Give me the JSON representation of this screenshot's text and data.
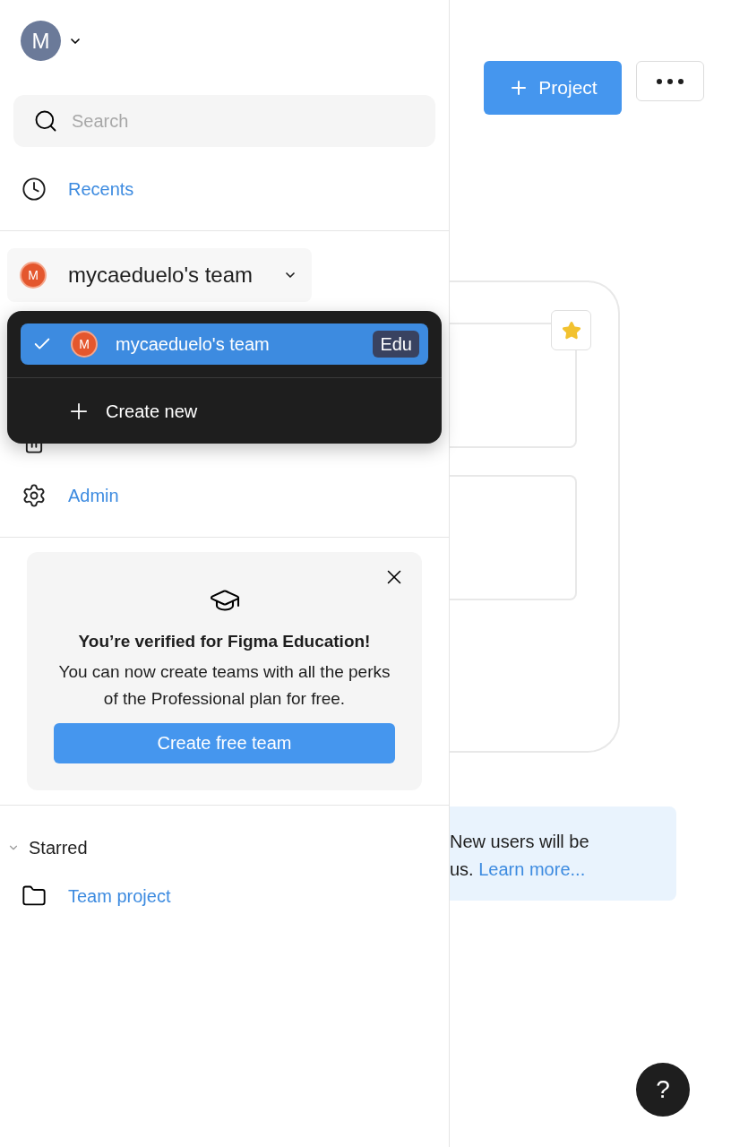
{
  "account": {
    "initial": "M"
  },
  "search": {
    "placeholder": "Search"
  },
  "nav": [
    {
      "label": "Recents",
      "kind": "clock"
    }
  ],
  "team_switcher": {
    "initial": "M",
    "name": "mycaeduelo's team"
  },
  "team_nav": [
    {
      "kind": "trash"
    },
    {
      "label": "Admin",
      "kind": "gear"
    }
  ],
  "team_menu": {
    "teams": [
      {
        "initial": "M",
        "name": "mycaeduelo's team",
        "badge": "Edu",
        "selected": true
      }
    ],
    "create_label": "Create new"
  },
  "promo": {
    "title": "You’re verified for Figma Education!",
    "body": "You can now create teams with all the perks of the Professional plan for free.",
    "button": "Create free team"
  },
  "starred": {
    "title": "Starred",
    "expanded": true,
    "items": [
      {
        "label": "Team project"
      }
    ]
  },
  "toolbar": {
    "new_button": "Project"
  },
  "file_card": {
    "starred": true
  },
  "banner": {
    "lines": [
      "New users will be",
      "us."
    ],
    "link": "Learn more..."
  },
  "help": {
    "label": "?"
  }
}
